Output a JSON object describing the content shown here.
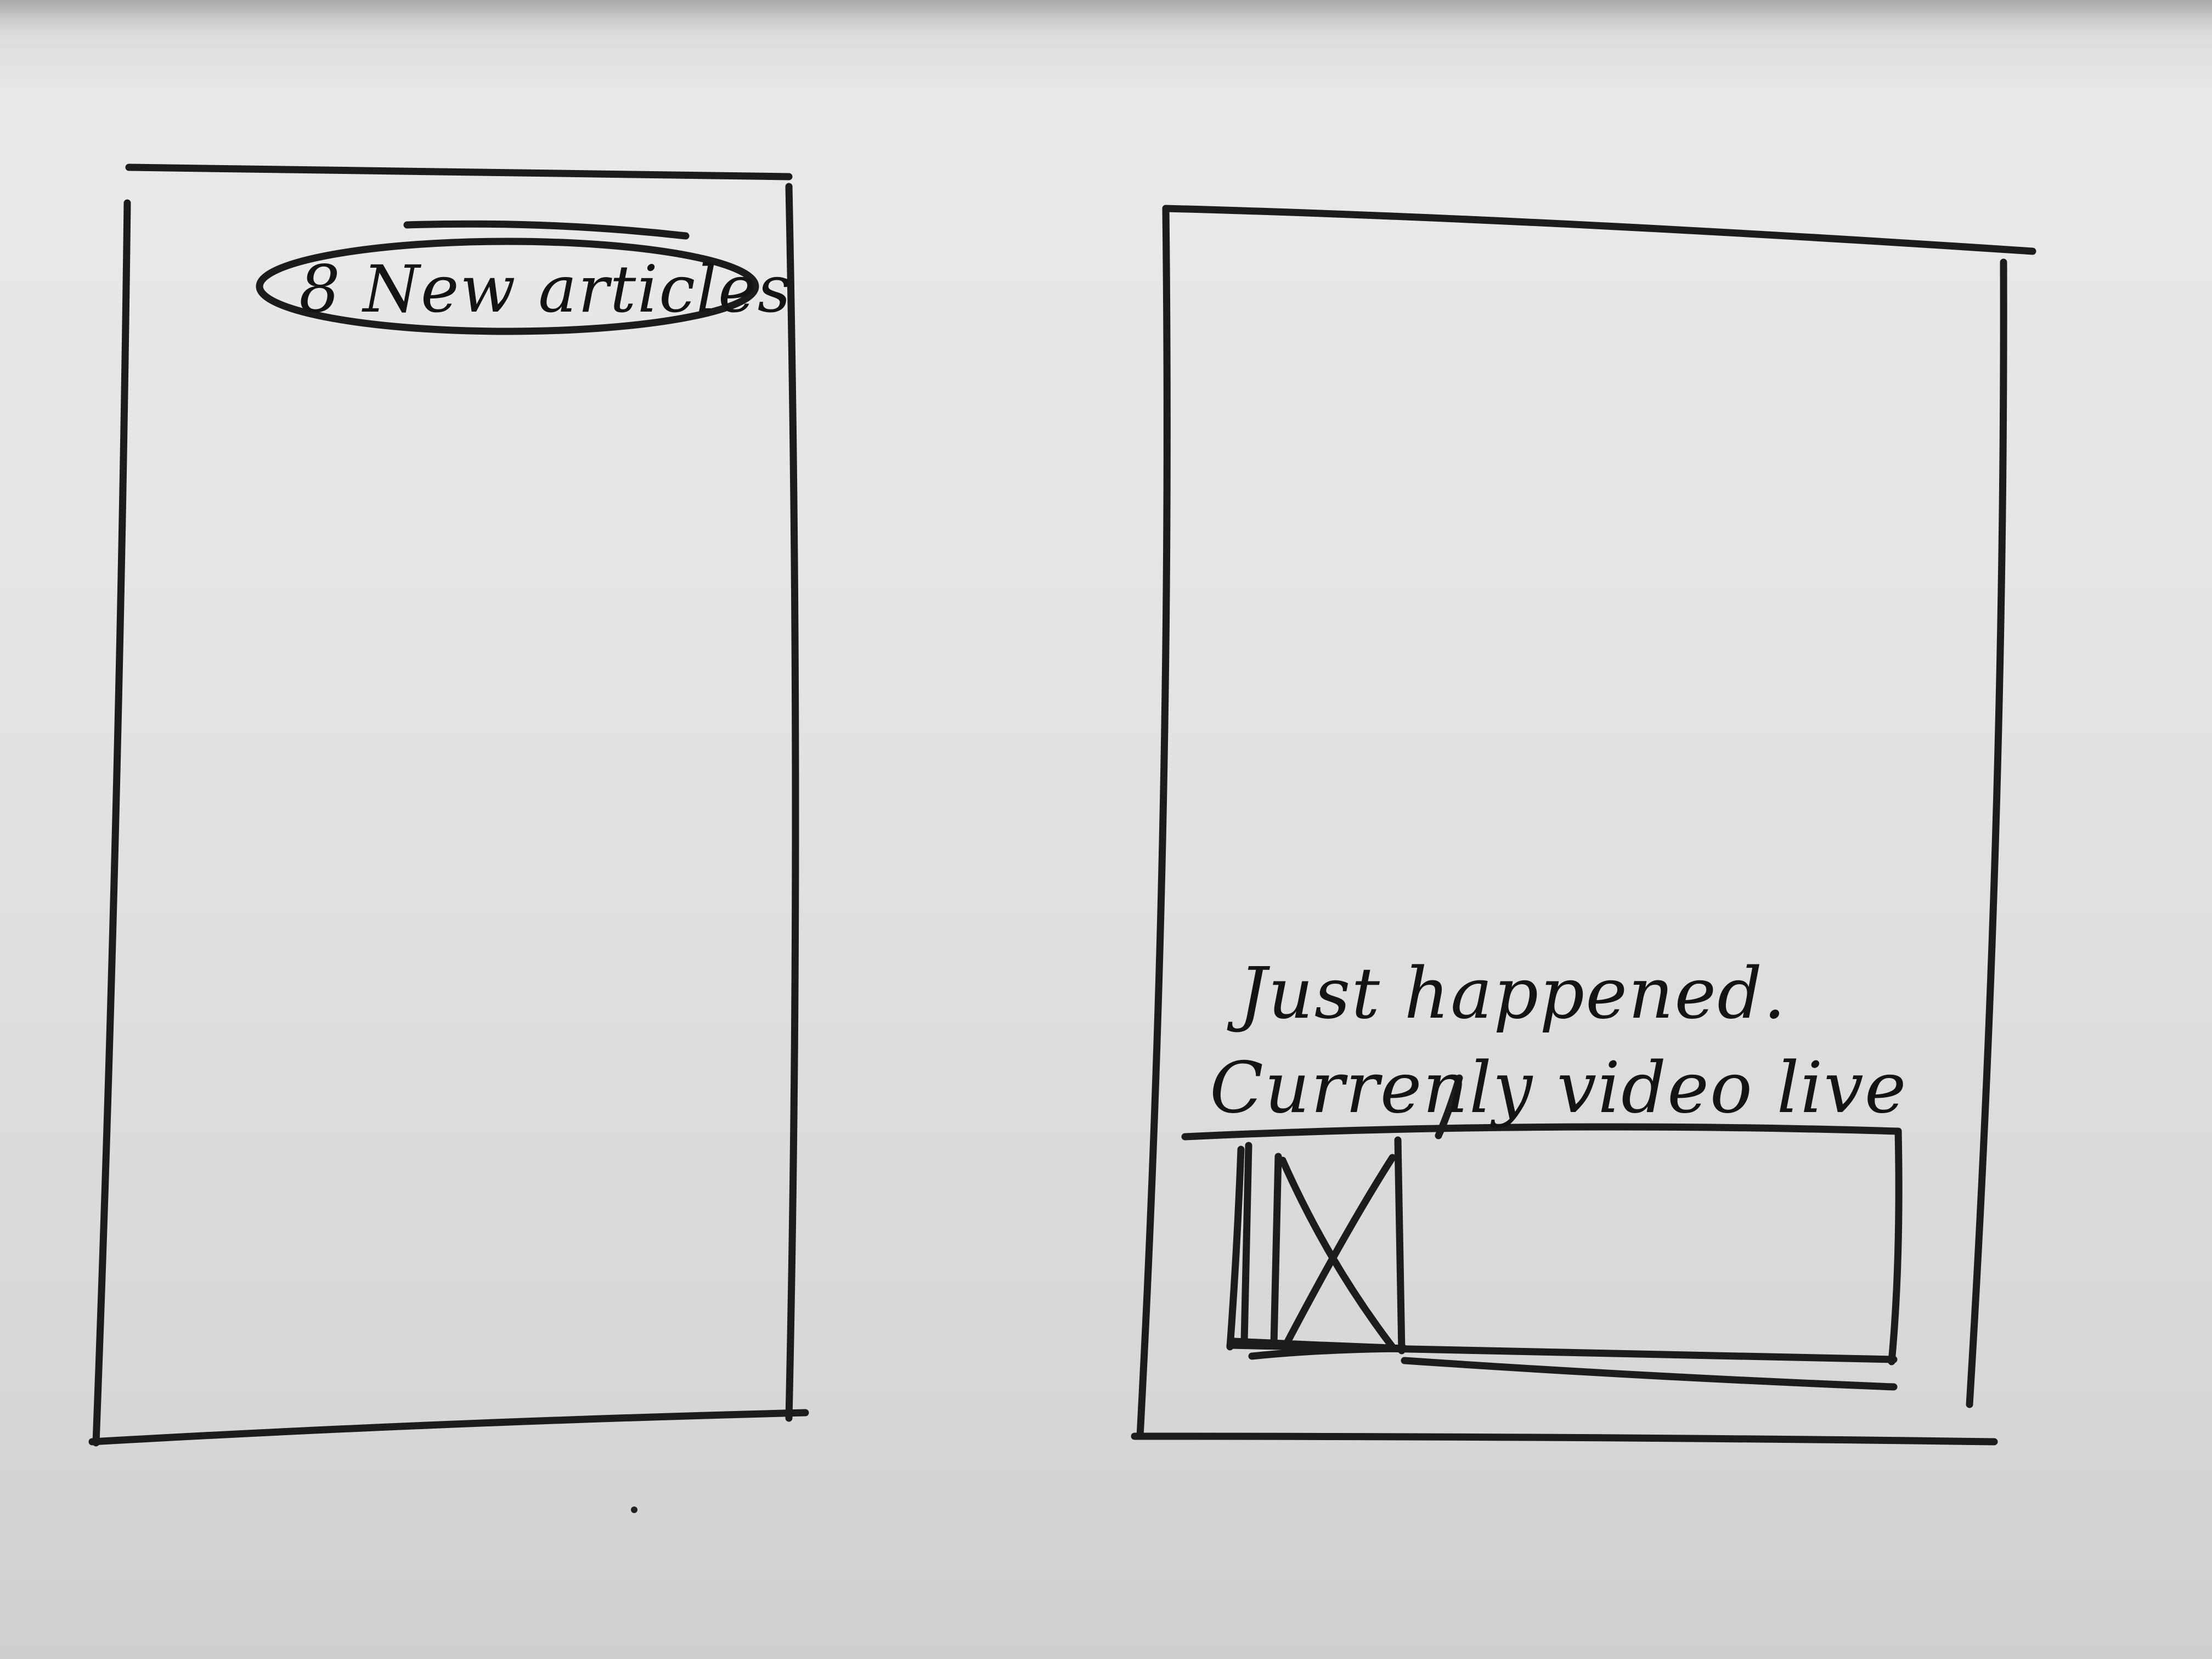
{
  "left_screen": {
    "new_articles_pill": {
      "label": "8 New articles"
    }
  },
  "right_screen": {
    "live_notice": {
      "line1": "Just happened.",
      "line2": "Currenly video live"
    },
    "video_card": {
      "thumbnail_icon": "image-placeholder-x-icon"
    }
  }
}
